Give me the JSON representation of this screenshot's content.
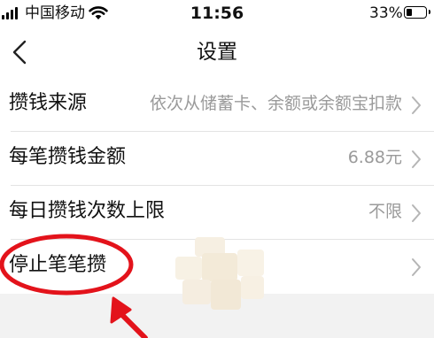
{
  "status_bar": {
    "carrier": "中国移动",
    "time": "11:56",
    "battery_percent_label": "33%",
    "battery_level": 0.33
  },
  "nav": {
    "title": "设置"
  },
  "settings": {
    "rows": [
      {
        "label": "攒钱来源",
        "value": "依次从储蓄卡、余额或余额宝扣款"
      },
      {
        "label": "每笔攒钱金额",
        "value": "6.88元"
      },
      {
        "label": "每日攒钱次数上限",
        "value": "不限"
      },
      {
        "label": "停止笔笔攒",
        "value": ""
      }
    ]
  },
  "colors": {
    "annotation": "#e3131b",
    "value_text": "#9a9a9a",
    "divider": "#e3e3e3",
    "page_bg": "#f2f2f2"
  }
}
